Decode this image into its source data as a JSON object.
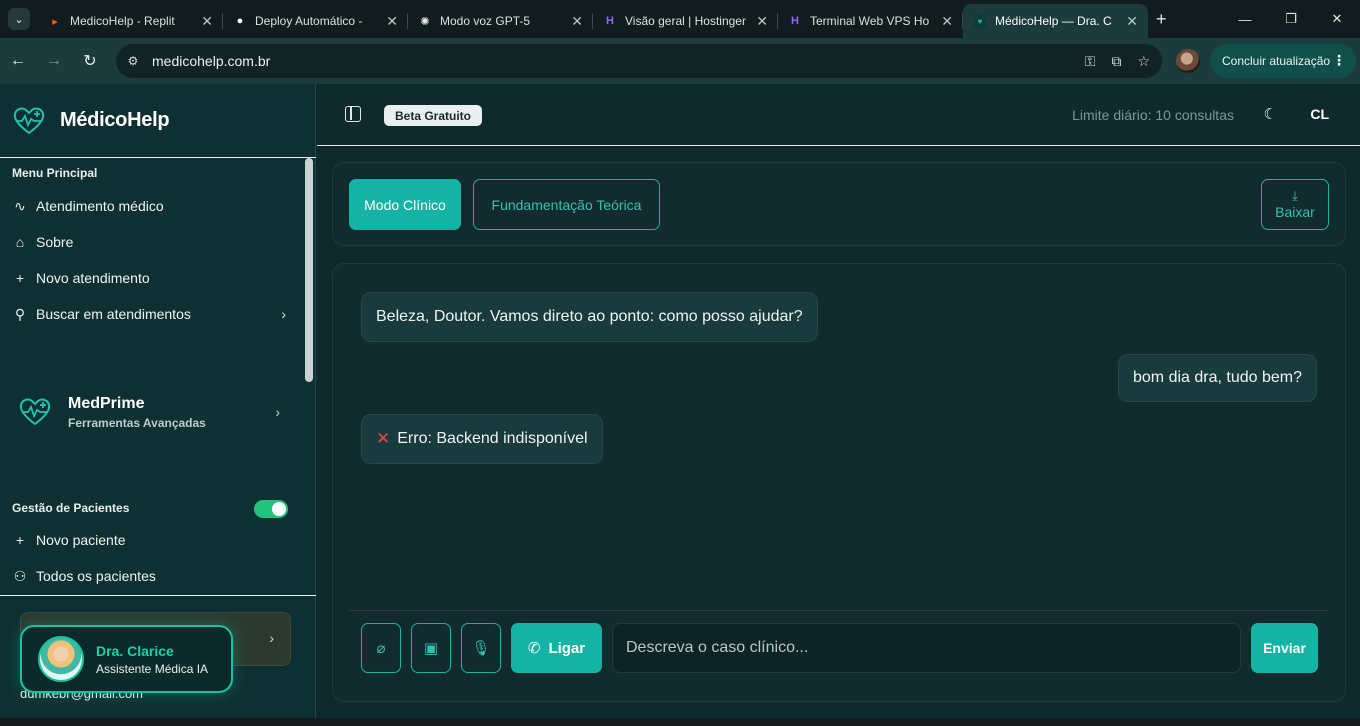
{
  "browser": {
    "tabs": [
      {
        "title": "MedicoHelp - Replit",
        "favicon": "replit-icon"
      },
      {
        "title": "Deploy Automático -",
        "favicon": "github-icon"
      },
      {
        "title": "Modo voz GPT-5",
        "favicon": "openai-icon"
      },
      {
        "title": "Visão geral | Hostinger",
        "favicon": "hostinger-icon"
      },
      {
        "title": "Terminal Web VPS Ho",
        "favicon": "hostinger-icon"
      },
      {
        "title": "MédicoHelp — Dra. C",
        "favicon": "medicohelp-icon",
        "active": true
      }
    ],
    "url": "medicohelp.com.br",
    "update_button": "Concluir atualização"
  },
  "sidebar": {
    "brand": "MédicoHelp",
    "menu_title": "Menu Principal",
    "menu_items": [
      {
        "label": "Atendimento médico",
        "icon": "activity-icon"
      },
      {
        "label": "Sobre",
        "icon": "home-icon"
      },
      {
        "label": "Novo atendimento",
        "icon": "plus-icon"
      },
      {
        "label": "Buscar em atendimentos",
        "icon": "search-icon"
      }
    ],
    "medprime": {
      "title": "MedPrime",
      "subtitle": "Ferramentas Avançadas"
    },
    "patients_title": "Gestão de Pacientes",
    "patients_toggle_on": true,
    "patient_items": [
      {
        "label": "Novo paciente",
        "icon": "plus-icon"
      },
      {
        "label": "Todos os pacientes",
        "icon": "users-icon"
      }
    ],
    "user_email": "dumkebr@gmail.com",
    "assistant": {
      "name": "Dra. Clarice",
      "role": "Assistente Médica IA"
    }
  },
  "header": {
    "badge": "Beta Gratuito",
    "limit": "Limite diário: 10 consultas",
    "user_initials": "CL"
  },
  "modes": {
    "clinical": "Modo Clínico",
    "theory": "Fundamentação Teórica",
    "download": "Baixar"
  },
  "chat": {
    "messages": [
      {
        "role": "assistant",
        "text": "Beleza, Doutor. Vamos direto ao ponto: como posso ajudar?"
      },
      {
        "role": "user",
        "text": "bom dia dra, tudo bem?"
      },
      {
        "role": "assistant",
        "text": "Erro: Backend indisponível",
        "error": true
      }
    ],
    "call_button": "Ligar",
    "input_placeholder": "Descreva o caso clínico...",
    "send_button": "Enviar"
  },
  "colors": {
    "accent": "#14b3a4",
    "sidebar_bg": "#0e3032",
    "panel_bg": "#122b2e",
    "assistant_name": "#19d3a8",
    "toggle_on": "#22c27f",
    "error": "#e5484d"
  }
}
